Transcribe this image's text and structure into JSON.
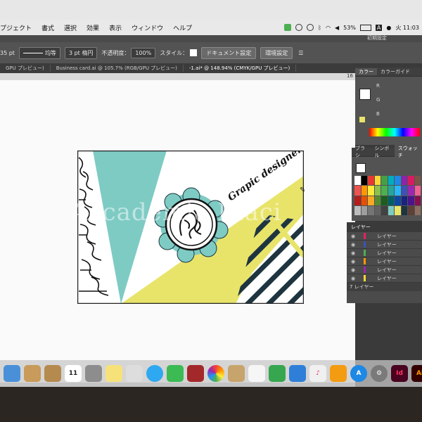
{
  "menubar": {
    "items": [
      "プジェクト",
      "書式",
      "選択",
      "効果",
      "表示",
      "ウィンドウ",
      "ヘルプ"
    ],
    "battery": "53%",
    "clock": "火 11:03"
  },
  "workspace_selector": "初期設定",
  "control_bar": {
    "stroke_size": "35 pt",
    "stroke_style": "均等",
    "brush": "3 pt 楕円",
    "opacity_label": "不透明度：",
    "opacity_value": "100%",
    "style_label": "スタイル：",
    "document_setup": "ドキュメント設定",
    "preferences": "環境設定"
  },
  "tabs": [
    "GPU プレビュー)",
    "Business card.ai @ 105.7% (RGB/GPU プレビュー)",
    "-1.ai* @ 148.94% (CMYK/GPU プレビュー)"
  ],
  "ruler_mark": "16",
  "color_panel": {
    "tab_color": "カラー",
    "tab_guide": "カラーガイド",
    "r": "R",
    "g": "G",
    "b": "B"
  },
  "swatch_panel": {
    "tab_brush": "ブラシ",
    "tab_symbol": "シンボル",
    "tab_swatch": "スウォッチ"
  },
  "layers_panel": {
    "title": "レイヤー",
    "rows": [
      "レイヤー",
      "レイヤー",
      "レイヤー",
      "レイヤー",
      "レイヤー",
      "レイヤー"
    ],
    "footer": "7 レイヤー"
  },
  "artwork": {
    "tagline": "Grapic designer",
    "watermark": "Accademia Riaci",
    "colors": {
      "teal": "#7ecbc4",
      "yellow": "#e8e46a",
      "navy": "#1e3540"
    }
  },
  "dock": {
    "calendar_day": "11",
    "app_id_label": "Id",
    "app_ai_label": "Ai"
  }
}
